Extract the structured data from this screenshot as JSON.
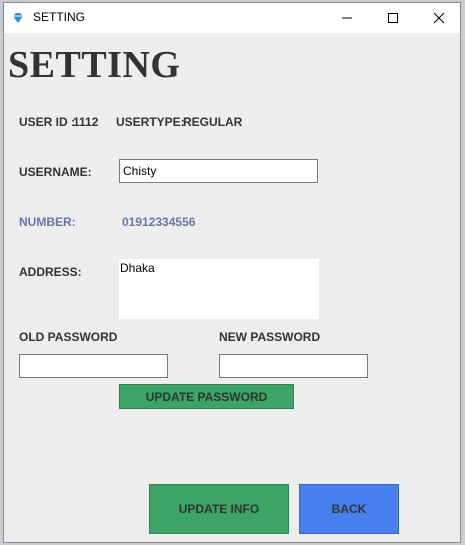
{
  "window": {
    "title": "SETTING",
    "icon": "diamond-app-icon"
  },
  "page": {
    "heading": "SETTING"
  },
  "user": {
    "id_label": "USER ID :",
    "id_value": "1112",
    "type_label": "USERTYPE:",
    "type_value": "REGULAR"
  },
  "form": {
    "username_label": "USERNAME:",
    "username_value": "Chisty",
    "number_label": "NUMBER:",
    "number_value": "01912334556",
    "address_label": "ADDRESS:",
    "address_value": "Dhaka",
    "old_password_label": "OLD PASSWORD",
    "old_password_value": "",
    "new_password_label": "NEW PASSWORD",
    "new_password_value": ""
  },
  "buttons": {
    "update_password": "UPDATE PASSWORD",
    "update_info": "UPDATE INFO",
    "back": "BACK"
  },
  "colors": {
    "green_button": "#3aa564",
    "blue_button": "#4680ee",
    "number_text": "#6a74a8",
    "background": "#eeeeee"
  }
}
